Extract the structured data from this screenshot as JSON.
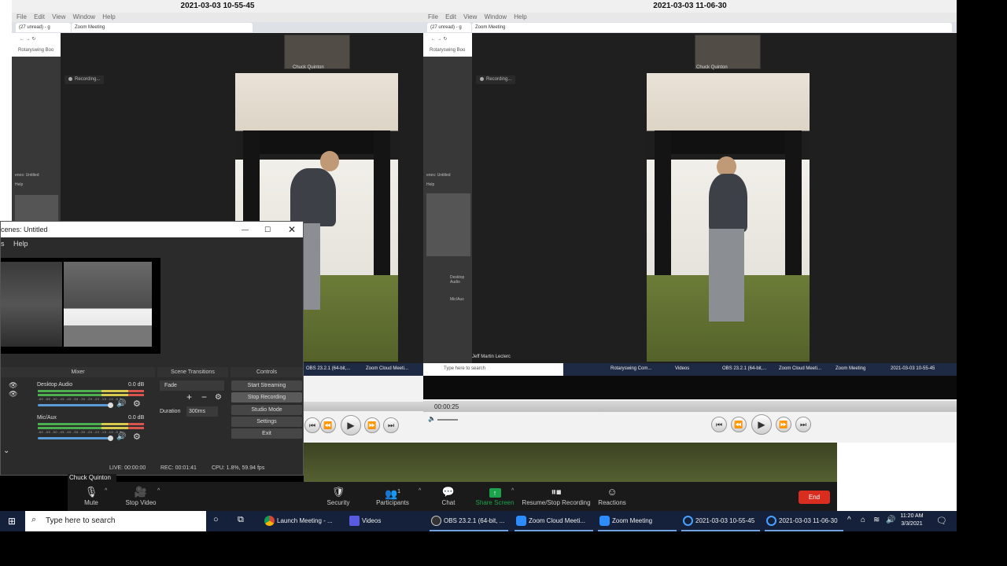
{
  "left_window": {
    "title": "2021-03-03 10-55-45",
    "menu": [
      "File",
      "Edit",
      "View",
      "Window",
      "Help"
    ],
    "tabs": [
      "(27 unread) - g",
      "Zoom Meeting"
    ],
    "bookmark": "Rotaryswing Boo",
    "recording_label": "Recording...",
    "thumb_name": "Chuck Quinton",
    "overlay_labels": [
      "enes: Untitled",
      "Help"
    ]
  },
  "right_window": {
    "title": "2021-03-03 11-06-30",
    "menu": [
      "File",
      "Edit",
      "View",
      "Window",
      "Help"
    ],
    "tabs": [
      "(27 unread) - g",
      "Zoom Meeting"
    ],
    "bookmark": "Rotaryswing Boo",
    "recording_label": "Recording...",
    "thumb_name": "Chuck Quinton",
    "speaker_name": "Jeff Martin Leclerc",
    "overlay_labels": [
      "enes: Untitled",
      "Help"
    ],
    "mini_mixer": [
      "Desktop Audio",
      "Mic/Aux"
    ],
    "overlay_taskbar": [
      "Type here to search",
      "Rotaryswing Com...",
      "Videos",
      "OBS 23.2.1 (64-bit,...",
      "Zoom Cloud Meeti...",
      "Zoom Meeting",
      "2021-03-03 10-55-45"
    ],
    "timestamp": "00:00:25"
  },
  "left_overlay_taskbar": [
    "OBS 23.2.1 (64-bit,...",
    "Zoom Cloud Meeti..."
  ],
  "obs": {
    "title": "cenes: Untitled",
    "menu": [
      "s",
      "Help"
    ],
    "panels": {
      "mixer": "Mixer",
      "transitions": "Scene Transitions",
      "controls": "Controls"
    },
    "desktop_audio": {
      "label": "Desktop Audio",
      "db": "0.0 dB"
    },
    "mic_aux": {
      "label": "Mic/Aux",
      "db": "0.0 dB"
    },
    "meter_ticks": "-60 -55 -50 -45 -40 -35 -30 -25 -20 -15 -10 -5 0",
    "transition": "Fade",
    "duration_label": "Duration",
    "duration_value": "300ms",
    "buttons": [
      "Start Streaming",
      "Stop Recording",
      "Studio Mode",
      "Settings",
      "Exit"
    ],
    "status": {
      "live": "LIVE: 00:00:00",
      "rec": "REC: 00:01:41",
      "cpu": "CPU: 1.8%, 59.94 fps"
    }
  },
  "zoom": {
    "speaker_name": "Chuck Quinton",
    "controls": [
      {
        "label": "Mute",
        "icon": "microphone-icon"
      },
      {
        "label": "Stop Video",
        "icon": "video-camera-icon"
      },
      {
        "label": "Security",
        "icon": "shield-icon"
      },
      {
        "label": "Participants",
        "icon": "participants-icon",
        "count": "1"
      },
      {
        "label": "Chat",
        "icon": "chat-icon"
      },
      {
        "label": "Share Screen",
        "icon": "share-screen-icon"
      },
      {
        "label": "Resume/Stop Recording",
        "icon": "record-icon"
      },
      {
        "label": "Reactions",
        "icon": "reactions-icon"
      }
    ],
    "end_label": "End",
    "share_color": "#1aa34a",
    "end_color": "#d92d20"
  },
  "taskbar": {
    "search_placeholder": "Type here to search",
    "items": [
      "Launch Meeting - ...",
      "Videos",
      "OBS 23.2.1 (64-bit, ...",
      "Zoom Cloud Meeti...",
      "Zoom Meeting",
      "2021-03-03 10-55-45",
      "2021-03-03 11-06-30"
    ],
    "time": "11:20 AM",
    "date": "3/3/2021"
  }
}
